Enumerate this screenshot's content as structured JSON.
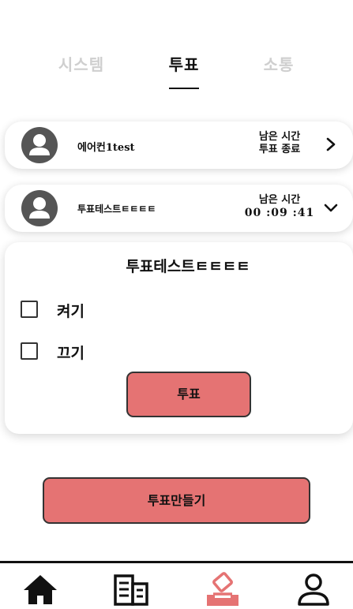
{
  "tabs": [
    {
      "label": "시스템",
      "active": false
    },
    {
      "label": "투표",
      "active": true
    },
    {
      "label": "소통",
      "active": false
    }
  ],
  "votes": [
    {
      "title": "에어컨1test",
      "time_label": "남은 시간",
      "time_value": "투표 종료",
      "chevron": "chevron-right-icon",
      "avatar": "user-avatar-icon"
    },
    {
      "title": "투표테스트ㅌㅌㅌㅌ",
      "time_label": "남은 시간",
      "time_value": "00 :09 :41",
      "chevron": "chevron-down-icon",
      "avatar": "user-avatar-icon"
    }
  ],
  "poll": {
    "title": "투표테스트ㅌㅌㅌㅌ",
    "options": [
      {
        "label": "켜기",
        "checked": false
      },
      {
        "label": "끄기",
        "checked": false
      }
    ],
    "submit_label": "투표"
  },
  "create_label": "투표만들기",
  "bottom_nav": [
    {
      "icon": "home-icon",
      "active": false
    },
    {
      "icon": "building-icon",
      "active": false
    },
    {
      "icon": "ballot-box-icon",
      "active": true
    },
    {
      "icon": "profile-icon",
      "active": false
    }
  ],
  "colors": {
    "accent": "#e57373",
    "text": "#111111",
    "inactive_tab": "#cfcfcf",
    "avatar": "#555555"
  }
}
